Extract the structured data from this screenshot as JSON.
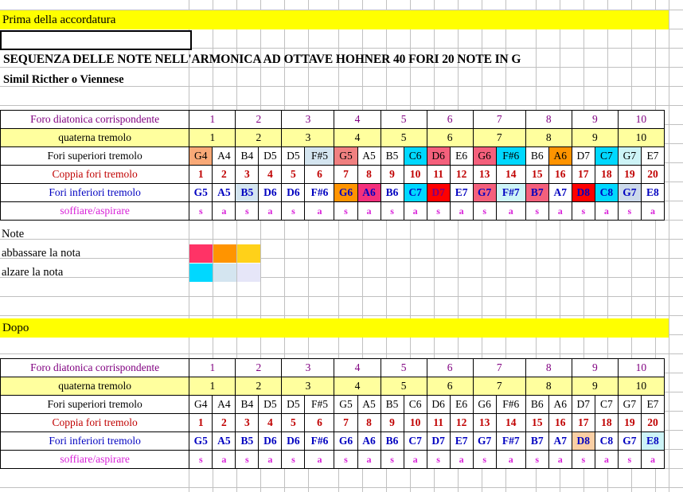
{
  "document": {
    "section_before_label": "Prima della accordatura",
    "input_box_value": "",
    "title": "SEQUENZA DELLE NOTE NELL'ARMONICA AD OTTAVE HOHNER 40 FORI 20 NOTE IN G",
    "subtitle": "Simil Ricther o Viennese",
    "section_after_label": "Dopo"
  },
  "row_labels": {
    "diatonic": "Foro diatonica corrispondente",
    "quaterna": "quaterna tremolo",
    "upper": "Fori superiori tremolo",
    "pair": "Coppia fori tremolo",
    "lower": "Fori inferiori tremolo",
    "breath": "soffiare/aspirare"
  },
  "legend": {
    "title": "Note",
    "lower_note_label": "abbassare la nota",
    "raise_note_label": "alzare la nota",
    "lower_swatches": [
      "#ff3366",
      "#ff9400",
      "#ffd119"
    ],
    "raise_swatches": [
      "#00d8ff",
      "#d4e5f0",
      "#e6e6f8"
    ]
  },
  "colors": {
    "yellow_band": "#ffff00",
    "row_yellow": "#ffff9e",
    "purple_text": "#800080",
    "red_text": "#c00000",
    "blue_text": "#0000c0",
    "magenta_text": "#d820d8",
    "peach": "#f9a977",
    "salmon": "#f08080",
    "crimson": "#ff3366",
    "cyan": "#00d8ff",
    "orange": "#ff9400",
    "lightblue": "#d4e5f0",
    "paleblue": "#ccf0f5",
    "pink": "#f4607c",
    "red": "#ff0000",
    "lavender": "#ccd9ea",
    "palecyan": "#cdf4f7",
    "peachlight": "#fbcfa4"
  },
  "table_before": {
    "diatonic": [
      "1",
      "1",
      "2",
      "2",
      "3",
      "3",
      "4",
      "4",
      "5",
      "5",
      "6",
      "6",
      "7",
      "7",
      "8",
      "8",
      "9",
      "9",
      "10",
      "10"
    ],
    "diatonic_spans": [
      2,
      2,
      2,
      2,
      2,
      2,
      2,
      2,
      2,
      2
    ],
    "diatonic_values": [
      "1",
      "2",
      "3",
      "4",
      "5",
      "6",
      "7",
      "8",
      "9",
      "10"
    ],
    "quaterna_values": [
      "1",
      "2",
      "3",
      "4",
      "5",
      "6",
      "7",
      "8",
      "9",
      "10"
    ],
    "upper": [
      {
        "note": "G4",
        "bg": "#f9a977",
        "fg": "#000000"
      },
      {
        "note": "A4",
        "bg": "#ffffff",
        "fg": "#000000"
      },
      {
        "note": "B4",
        "bg": "#ffffff",
        "fg": "#000000"
      },
      {
        "note": "D5",
        "bg": "#ffffff",
        "fg": "#000000"
      },
      {
        "note": "D5",
        "bg": "#ffffff",
        "fg": "#000000"
      },
      {
        "note": "F#5",
        "bg": "#d4e5f0",
        "fg": "#000000"
      },
      {
        "note": "G5",
        "bg": "#f08080",
        "fg": "#000000"
      },
      {
        "note": "A5",
        "bg": "#ffffff",
        "fg": "#000000"
      },
      {
        "note": "B5",
        "bg": "#ffffff",
        "fg": "#000000"
      },
      {
        "note": "C6",
        "bg": "#00d8ff",
        "fg": "#000000"
      },
      {
        "note": "D6",
        "bg": "#f4607c",
        "fg": "#000000"
      },
      {
        "note": "E6",
        "bg": "#ffffff",
        "fg": "#000000"
      },
      {
        "note": "G6",
        "bg": "#f4607c",
        "fg": "#000000"
      },
      {
        "note": "F#6",
        "bg": "#00d8ff",
        "fg": "#000000"
      },
      {
        "note": "B6",
        "bg": "#ffffff",
        "fg": "#000000"
      },
      {
        "note": "A6",
        "bg": "#ff9400",
        "fg": "#000000"
      },
      {
        "note": "D7",
        "bg": "#ffffff",
        "fg": "#000000"
      },
      {
        "note": "C7",
        "bg": "#00d8ff",
        "fg": "#000000"
      },
      {
        "note": "G7",
        "bg": "#cdf4f7",
        "fg": "#000000"
      },
      {
        "note": "E7",
        "bg": "#ffffff",
        "fg": "#000000"
      }
    ],
    "pair": [
      "1",
      "2",
      "3",
      "4",
      "5",
      "6",
      "7",
      "8",
      "9",
      "10",
      "11",
      "12",
      "13",
      "14",
      "15",
      "16",
      "17",
      "18",
      "19",
      "20"
    ],
    "lower": [
      {
        "note": "G5",
        "bg": "#ffffff",
        "fg": "#0000c0"
      },
      {
        "note": "A5",
        "bg": "#ffffff",
        "fg": "#0000c0"
      },
      {
        "note": "B5",
        "bg": "#d4e5f0",
        "fg": "#0000c0"
      },
      {
        "note": "D6",
        "bg": "#ffffff",
        "fg": "#0000c0"
      },
      {
        "note": "D6",
        "bg": "#ffffff",
        "fg": "#0000c0"
      },
      {
        "note": "F#6",
        "bg": "#ffffff",
        "fg": "#0000c0"
      },
      {
        "note": "G6",
        "bg": "#ff9400",
        "fg": "#0000c0"
      },
      {
        "note": "A6",
        "bg": "#f4307c",
        "fg": "#0000c0"
      },
      {
        "note": "B6",
        "bg": "#ffffff",
        "fg": "#0000c0"
      },
      {
        "note": "C7",
        "bg": "#00d8ff",
        "fg": "#0000c0"
      },
      {
        "note": "D7",
        "bg": "#ff0000",
        "fg": "#800080"
      },
      {
        "note": "E7",
        "bg": "#ffffff",
        "fg": "#0000c0"
      },
      {
        "note": "G7",
        "bg": "#f4607c",
        "fg": "#0000c0"
      },
      {
        "note": "F#7",
        "bg": "#cdf4f7",
        "fg": "#0000c0"
      },
      {
        "note": "B7",
        "bg": "#f4607c",
        "fg": "#0000c0"
      },
      {
        "note": "A7",
        "bg": "#ffffff",
        "fg": "#0000c0"
      },
      {
        "note": "D8",
        "bg": "#ff0000",
        "fg": "#0000c0"
      },
      {
        "note": "C8",
        "bg": "#00d8ff",
        "fg": "#0000c0"
      },
      {
        "note": "G7",
        "bg": "#ccd9ea",
        "fg": "#0000c0"
      },
      {
        "note": "E8",
        "bg": "#ffffff",
        "fg": "#0000c0"
      }
    ],
    "breath": [
      "s",
      "a",
      "s",
      "a",
      "s",
      "a",
      "s",
      "a",
      "s",
      "a",
      "s",
      "a",
      "s",
      "a",
      "s",
      "a",
      "s",
      "a",
      "s",
      "a"
    ]
  },
  "table_after": {
    "diatonic_values": [
      "1",
      "2",
      "3",
      "4",
      "5",
      "6",
      "7",
      "8",
      "9",
      "10"
    ],
    "quaterna_values": [
      "1",
      "2",
      "3",
      "4",
      "5",
      "6",
      "7",
      "8",
      "9",
      "10"
    ],
    "upper": [
      {
        "note": "G4",
        "bg": "#ffffff",
        "fg": "#000000"
      },
      {
        "note": "A4",
        "bg": "#ffffff",
        "fg": "#000000"
      },
      {
        "note": "B4",
        "bg": "#ffffff",
        "fg": "#000000"
      },
      {
        "note": "D5",
        "bg": "#ffffff",
        "fg": "#000000"
      },
      {
        "note": "D5",
        "bg": "#ffffff",
        "fg": "#000000"
      },
      {
        "note": "F#5",
        "bg": "#ffffff",
        "fg": "#000000"
      },
      {
        "note": "G5",
        "bg": "#ffffff",
        "fg": "#000000"
      },
      {
        "note": "A5",
        "bg": "#ffffff",
        "fg": "#000000"
      },
      {
        "note": "B5",
        "bg": "#ffffff",
        "fg": "#000000"
      },
      {
        "note": "C6",
        "bg": "#ffffff",
        "fg": "#000000"
      },
      {
        "note": "D6",
        "bg": "#ffffff",
        "fg": "#000000"
      },
      {
        "note": "E6",
        "bg": "#ffffff",
        "fg": "#000000"
      },
      {
        "note": "G6",
        "bg": "#ffffff",
        "fg": "#000000"
      },
      {
        "note": "F#6",
        "bg": "#ffffff",
        "fg": "#000000"
      },
      {
        "note": "B6",
        "bg": "#ffffff",
        "fg": "#000000"
      },
      {
        "note": "A6",
        "bg": "#ffffff",
        "fg": "#000000"
      },
      {
        "note": "D7",
        "bg": "#ffffff",
        "fg": "#000000"
      },
      {
        "note": "C7",
        "bg": "#ffffff",
        "fg": "#000000"
      },
      {
        "note": "G7",
        "bg": "#ffffff",
        "fg": "#000000"
      },
      {
        "note": "E7",
        "bg": "#ffffff",
        "fg": "#000000"
      }
    ],
    "pair": [
      "1",
      "2",
      "3",
      "4",
      "5",
      "6",
      "7",
      "8",
      "9",
      "10",
      "11",
      "12",
      "13",
      "14",
      "15",
      "16",
      "17",
      "18",
      "19",
      "20"
    ],
    "lower": [
      {
        "note": "G5",
        "bg": "#ffffff",
        "fg": "#0000c0"
      },
      {
        "note": "A5",
        "bg": "#ffffff",
        "fg": "#0000c0"
      },
      {
        "note": "B5",
        "bg": "#ffffff",
        "fg": "#0000c0"
      },
      {
        "note": "D6",
        "bg": "#ffffff",
        "fg": "#0000c0"
      },
      {
        "note": "D6",
        "bg": "#ffffff",
        "fg": "#0000c0"
      },
      {
        "note": "F#6",
        "bg": "#ffffff",
        "fg": "#0000c0"
      },
      {
        "note": "G6",
        "bg": "#ffffff",
        "fg": "#0000c0"
      },
      {
        "note": "A6",
        "bg": "#ffffff",
        "fg": "#0000c0"
      },
      {
        "note": "B6",
        "bg": "#ffffff",
        "fg": "#0000c0"
      },
      {
        "note": "C7",
        "bg": "#ffffff",
        "fg": "#0000c0"
      },
      {
        "note": "D7",
        "bg": "#ffffff",
        "fg": "#0000c0"
      },
      {
        "note": "E7",
        "bg": "#ffffff",
        "fg": "#0000c0"
      },
      {
        "note": "G7",
        "bg": "#ffffff",
        "fg": "#0000c0"
      },
      {
        "note": "F#7",
        "bg": "#ffffff",
        "fg": "#0000c0"
      },
      {
        "note": "B7",
        "bg": "#ffffff",
        "fg": "#0000c0"
      },
      {
        "note": "A7",
        "bg": "#ffffff",
        "fg": "#0000c0"
      },
      {
        "note": "D8",
        "bg": "#fbcfa4",
        "fg": "#0000c0"
      },
      {
        "note": "C8",
        "bg": "#ffffff",
        "fg": "#0000c0"
      },
      {
        "note": "G7",
        "bg": "#ffffff",
        "fg": "#0000c0"
      },
      {
        "note": "E8",
        "bg": "#cdf4f7",
        "fg": "#0000c0"
      }
    ],
    "breath": [
      "s",
      "a",
      "s",
      "a",
      "s",
      "a",
      "s",
      "a",
      "s",
      "a",
      "s",
      "a",
      "s",
      "a",
      "s",
      "a",
      "s",
      "a",
      "s",
      "a"
    ]
  }
}
